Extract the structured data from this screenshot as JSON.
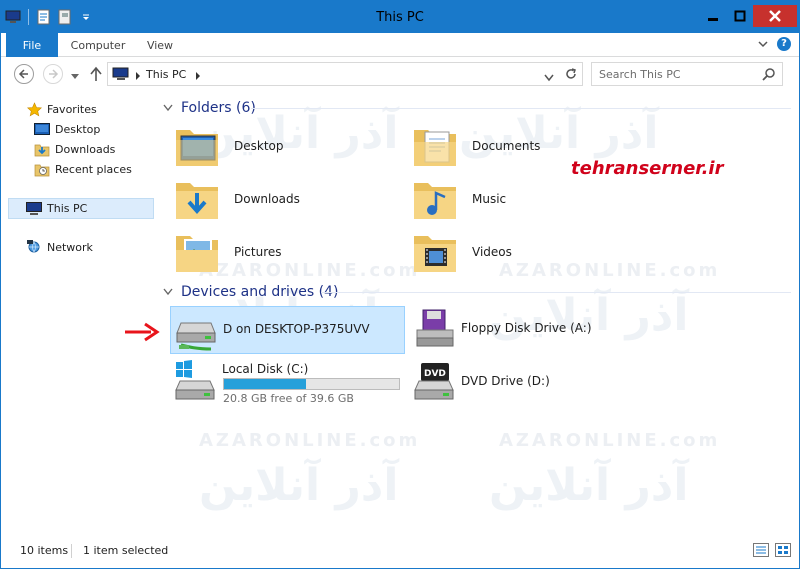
{
  "window": {
    "title": "This PC"
  },
  "ribbon": {
    "tabs": [
      {
        "label": "File"
      },
      {
        "label": "Computer"
      },
      {
        "label": "View"
      }
    ]
  },
  "address": {
    "crumb": "This PC",
    "search_placeholder": "Search This PC"
  },
  "navpane": {
    "favorites": "Favorites",
    "desktop": "Desktop",
    "downloads": "Downloads",
    "recent": "Recent places",
    "thispc": "This PC",
    "network": "Network"
  },
  "groups": {
    "folders": "Folders (6)",
    "devices": "Devices and drives (4)"
  },
  "folders": [
    {
      "label": "Desktop",
      "icon": "folder-desktop-icon"
    },
    {
      "label": "Documents",
      "icon": "folder-documents-icon"
    },
    {
      "label": "Downloads",
      "icon": "folder-downloads-icon"
    },
    {
      "label": "Music",
      "icon": "folder-music-icon"
    },
    {
      "label": "Pictures",
      "icon": "folder-pictures-icon"
    },
    {
      "label": "Videos",
      "icon": "folder-videos-icon"
    }
  ],
  "drives": {
    "network": {
      "label": "D on DESKTOP-P375UVV"
    },
    "floppy": {
      "label": "Floppy Disk Drive (A:)"
    },
    "local": {
      "label": "Local Disk (C:)",
      "free": "20.8 GB free of 39.6 GB",
      "used_fraction": 0.47
    },
    "dvd": {
      "label": "DVD Drive (D:)"
    }
  },
  "overlay": {
    "brand": "tehranserner.ir"
  },
  "status": {
    "count": "10 items",
    "selection": "1 item selected"
  },
  "colors": {
    "accent": "#1979ca",
    "selection": "#cce8ff",
    "folder": "#f6d584",
    "bar": "#26a0da",
    "arrow": "#e8141b"
  }
}
